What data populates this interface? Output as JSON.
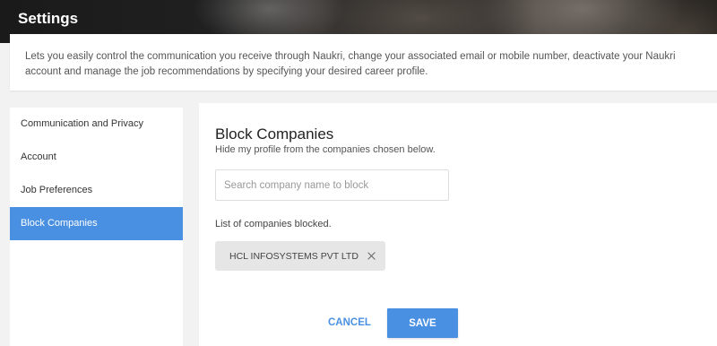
{
  "header": {
    "title": "Settings"
  },
  "intro": {
    "text": "Lets you easily control the communication you receive through Naukri, change your associated email or mobile number, deactivate your Naukri account and manage the job recommendations by specifying your desired career profile."
  },
  "sidebar": {
    "items": [
      {
        "label": "Communication and Privacy",
        "active": false
      },
      {
        "label": "Account",
        "active": false
      },
      {
        "label": "Job Preferences",
        "active": false
      },
      {
        "label": "Block Companies",
        "active": true
      }
    ]
  },
  "block_companies": {
    "title": "Block Companies",
    "subtitle": "Hide my profile from the companies chosen below.",
    "search": {
      "placeholder": "Search company name to block",
      "value": ""
    },
    "list_label": "List of companies blocked.",
    "blocked": [
      {
        "name": "HCL INFOSYSTEMS PVT LTD",
        "remove_icon": "close-icon"
      }
    ],
    "actions": {
      "cancel_label": "CANCEL",
      "save_label": "SAVE"
    }
  },
  "colors": {
    "accent": "#4a90e2",
    "chip_bg": "#e6e6e6",
    "page_bg": "#f2f2f2"
  }
}
